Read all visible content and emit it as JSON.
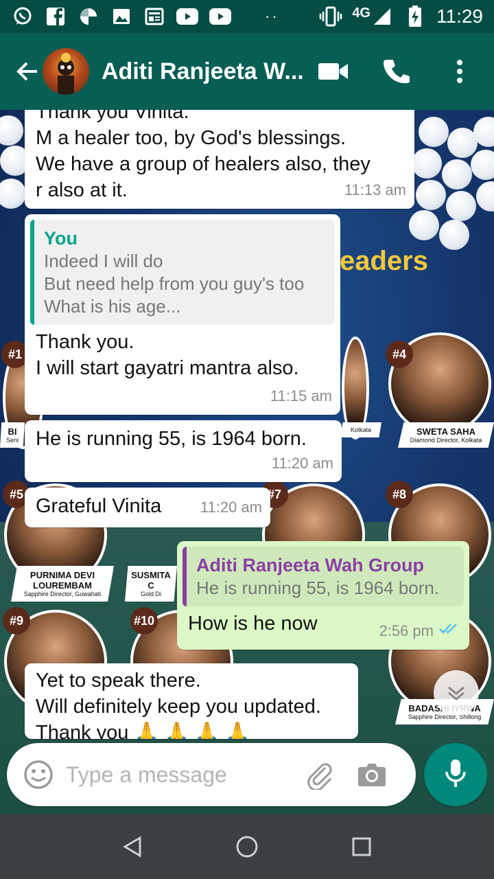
{
  "status_bar": {
    "network": "4G",
    "time": "11:29",
    "dots": "··"
  },
  "header": {
    "title": "Aditi Ranjeeta W...",
    "colors": {
      "bar": "#075e54",
      "status": "#054d44"
    }
  },
  "background": {
    "heading_fragment": "eaders",
    "ranks": [
      "#1",
      "#4",
      "#5",
      "#7",
      "#8",
      "#9",
      "#10"
    ],
    "nameplates": [
      {
        "name": "SWETA SAHA",
        "role": "Diamond Director, Kolkata"
      },
      {
        "name": "PURNIMA DEVI LOUREMBAM",
        "role": "Sapphire Director, Guwahati"
      },
      {
        "name": "SUSMITA C",
        "role": "Gold Di"
      },
      {
        "name": "BADASHI IYRWA",
        "role": "Sapphire Director, Shillong"
      },
      {
        "name": "Kolkata",
        "role": ""
      },
      {
        "name": "BI",
        "role": "Seni"
      }
    ]
  },
  "messages": [
    {
      "direction": "incoming",
      "lines": [
        "Thank you Vinita.",
        "M a healer too, by God's blessings.",
        "We have a group of healers also, they",
        "r also at it."
      ],
      "time": "11:13 am"
    },
    {
      "direction": "incoming",
      "quote": {
        "author": "You",
        "lines": [
          "Indeed I will do",
          "But need help from you guy's too",
          "What is his age..."
        ]
      },
      "lines": [
        "Thank you.",
        "I will start gayatri mantra also."
      ],
      "time": "11:15 am"
    },
    {
      "direction": "incoming",
      "lines": [
        "He is running 55, is 1964 born."
      ],
      "time": "11:20 am"
    },
    {
      "direction": "incoming",
      "lines": [
        "Grateful Vinita"
      ],
      "time": "11:20 am"
    },
    {
      "direction": "outgoing",
      "quote": {
        "author": "Aditi Ranjeeta Wah Group",
        "lines": [
          "He is running 55, is 1964 born."
        ]
      },
      "lines": [
        "How is he now"
      ],
      "time": "2:56 pm",
      "status": "read"
    },
    {
      "direction": "incoming",
      "lines": [
        "Yet to speak there.",
        "Will definitely keep you updated.",
        "Thank you 🙏 🙏 🙏 🙏"
      ],
      "time": ""
    }
  ],
  "composer": {
    "placeholder": "Type a message",
    "value": ""
  },
  "icons": {
    "statusbar": [
      "whatsapp-icon",
      "facebook-icon",
      "pinwheel-icon",
      "gallery-icon",
      "news-icon",
      "youtube-icon",
      "youtube-icon",
      "vibrate-icon",
      "signal-icon",
      "battery-charging-icon"
    ],
    "header": [
      "back-arrow-icon",
      "video-call-icon",
      "phone-icon",
      "more-vert-icon"
    ],
    "composer": [
      "emoji-icon",
      "attach-icon",
      "camera-icon",
      "mic-icon"
    ],
    "nav": [
      "nav-back-icon",
      "nav-home-icon",
      "nav-recents-icon"
    ]
  }
}
